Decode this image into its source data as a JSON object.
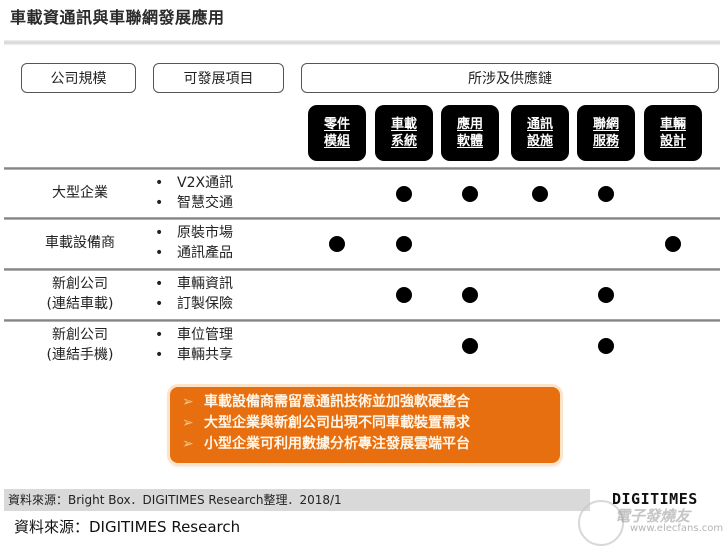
{
  "title": "車載資通訊與車聯網發展應用",
  "headers": {
    "company_scale": "公司規模",
    "dev_items": "可發展項目",
    "supply_chain": "所涉及供應鏈"
  },
  "supply_chain_categories": [
    {
      "line1": "零件",
      "line2": "模組"
    },
    {
      "line1": "車載",
      "line2": "系統"
    },
    {
      "line1": "應用",
      "line2": "軟體"
    },
    {
      "line1": "通訊",
      "line2": "設施"
    },
    {
      "line1": "聯網",
      "line2": "服務"
    },
    {
      "line1": "車輛",
      "line2": "設計"
    }
  ],
  "rows": [
    {
      "scale_line1": "大型企業",
      "scale_line2": "",
      "items": [
        "V2X通訊",
        "智慧交通"
      ],
      "marks": [
        false,
        true,
        true,
        true,
        true,
        false
      ]
    },
    {
      "scale_line1": "車載設備商",
      "scale_line2": "",
      "items": [
        "原裝市場",
        "通訊產品"
      ],
      "marks": [
        true,
        true,
        false,
        false,
        false,
        true
      ]
    },
    {
      "scale_line1": "新創公司",
      "scale_line2": "(連結車載)",
      "items": [
        "車輛資訊",
        "訂製保險"
      ],
      "marks": [
        false,
        true,
        true,
        false,
        true,
        false
      ]
    },
    {
      "scale_line1": "新創公司",
      "scale_line2": "(連結手機)",
      "items": [
        "車位管理",
        "車輛共享"
      ],
      "marks": [
        false,
        false,
        true,
        false,
        true,
        false
      ]
    }
  ],
  "notes": [
    "車載設備商需留意通訊技術並加強軟硬整合",
    "大型企業與新創公司出現不同車載裝置需求",
    "小型企業可利用數據分析專注發展雲端平台"
  ],
  "source_bar": "資料來源：Bright Box．DIGITIMES Research整理．2018/1",
  "logo": "DIGITIMES",
  "watermark": {
    "cn": "電子發燒友",
    "url": "www.elecfans.com"
  },
  "source_caption": "資料來源：DIGITIMES Research",
  "colors": {
    "note_bg": "#e86f10",
    "chip_bg": "#000000",
    "source_bar_bg": "#d9d9d9"
  }
}
